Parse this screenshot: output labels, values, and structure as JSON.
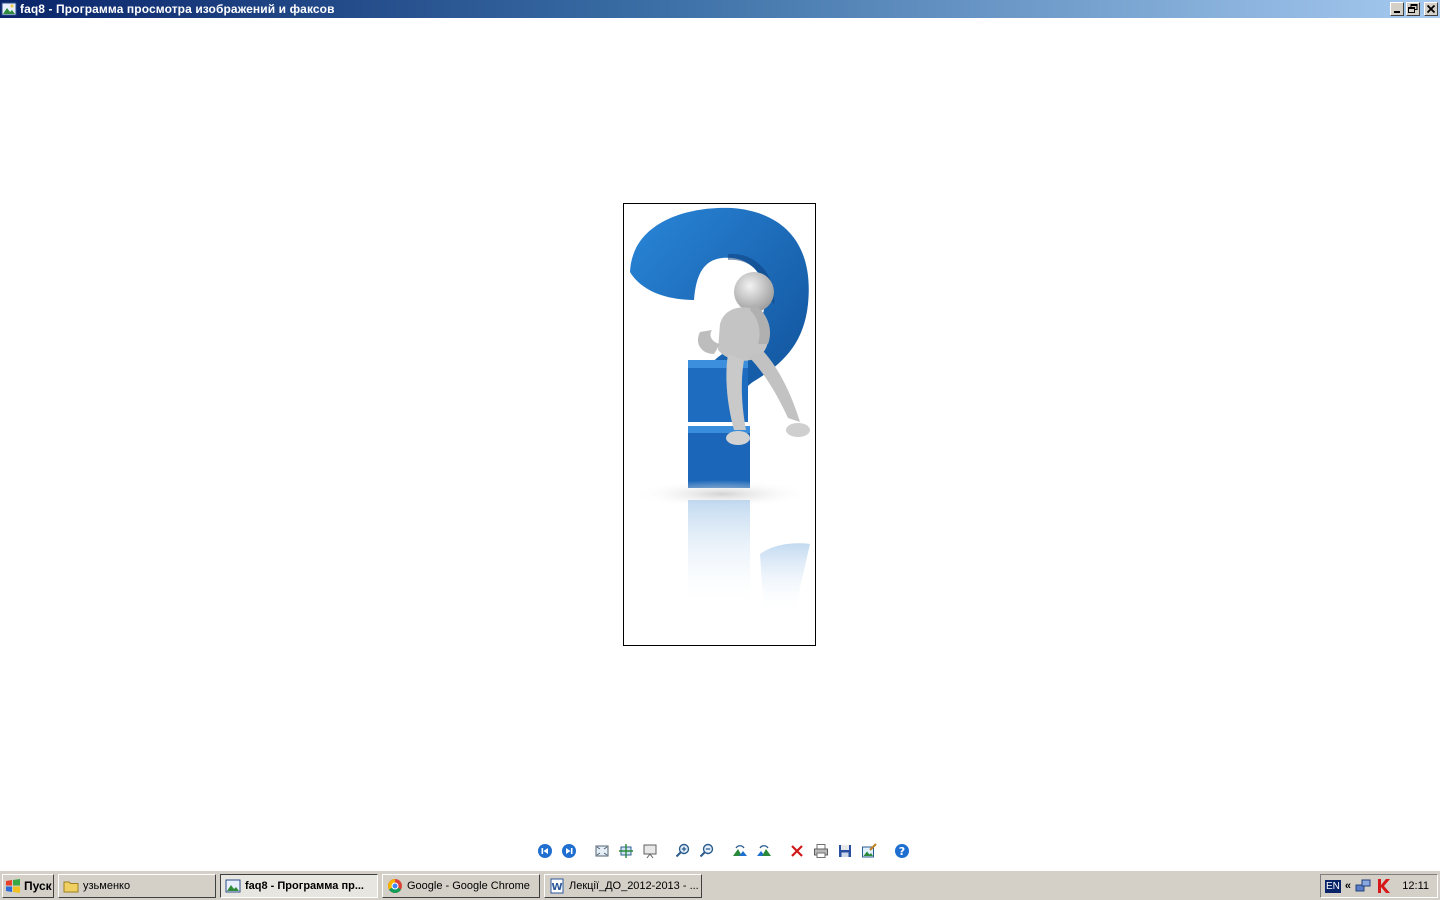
{
  "window": {
    "title": "faq8 - Программа просмотра изображений и факсов",
    "icons": {
      "app": "image-viewer-icon",
      "minimize": "minimize-icon",
      "restore": "restore-icon",
      "close": "close-icon"
    }
  },
  "image": {
    "description_icon": "question-mark-thinker-image"
  },
  "toolbar": {
    "buttons": [
      "previous-image-icon",
      "next-image-icon",
      "best-fit-icon",
      "actual-size-icon",
      "slideshow-icon",
      "zoom-in-icon",
      "zoom-out-icon",
      "rotate-clockwise-icon",
      "rotate-counterclockwise-icon",
      "delete-icon",
      "print-icon",
      "save-icon",
      "edit-icon",
      "help-icon"
    ]
  },
  "taskbar": {
    "start_label": "Пуск",
    "tasks": [
      {
        "label": "узьменко",
        "icon": "folder-icon"
      },
      {
        "label": "faq8 - Программа пр...",
        "icon": "image-viewer-icon",
        "active": true
      },
      {
        "label": "Google - Google Chrome",
        "icon": "chrome-icon"
      },
      {
        "label": "Лекції_ДО_2012-2013 - ...",
        "icon": "word-icon"
      }
    ],
    "tray": {
      "language": "EN",
      "expand": "«",
      "clock": "12:11"
    }
  },
  "colors": {
    "titlebar_start": "#0a246a",
    "titlebar_end": "#a6caf0",
    "question_blue": "#1e6fc0",
    "taskbar": "#d4d0c8"
  }
}
